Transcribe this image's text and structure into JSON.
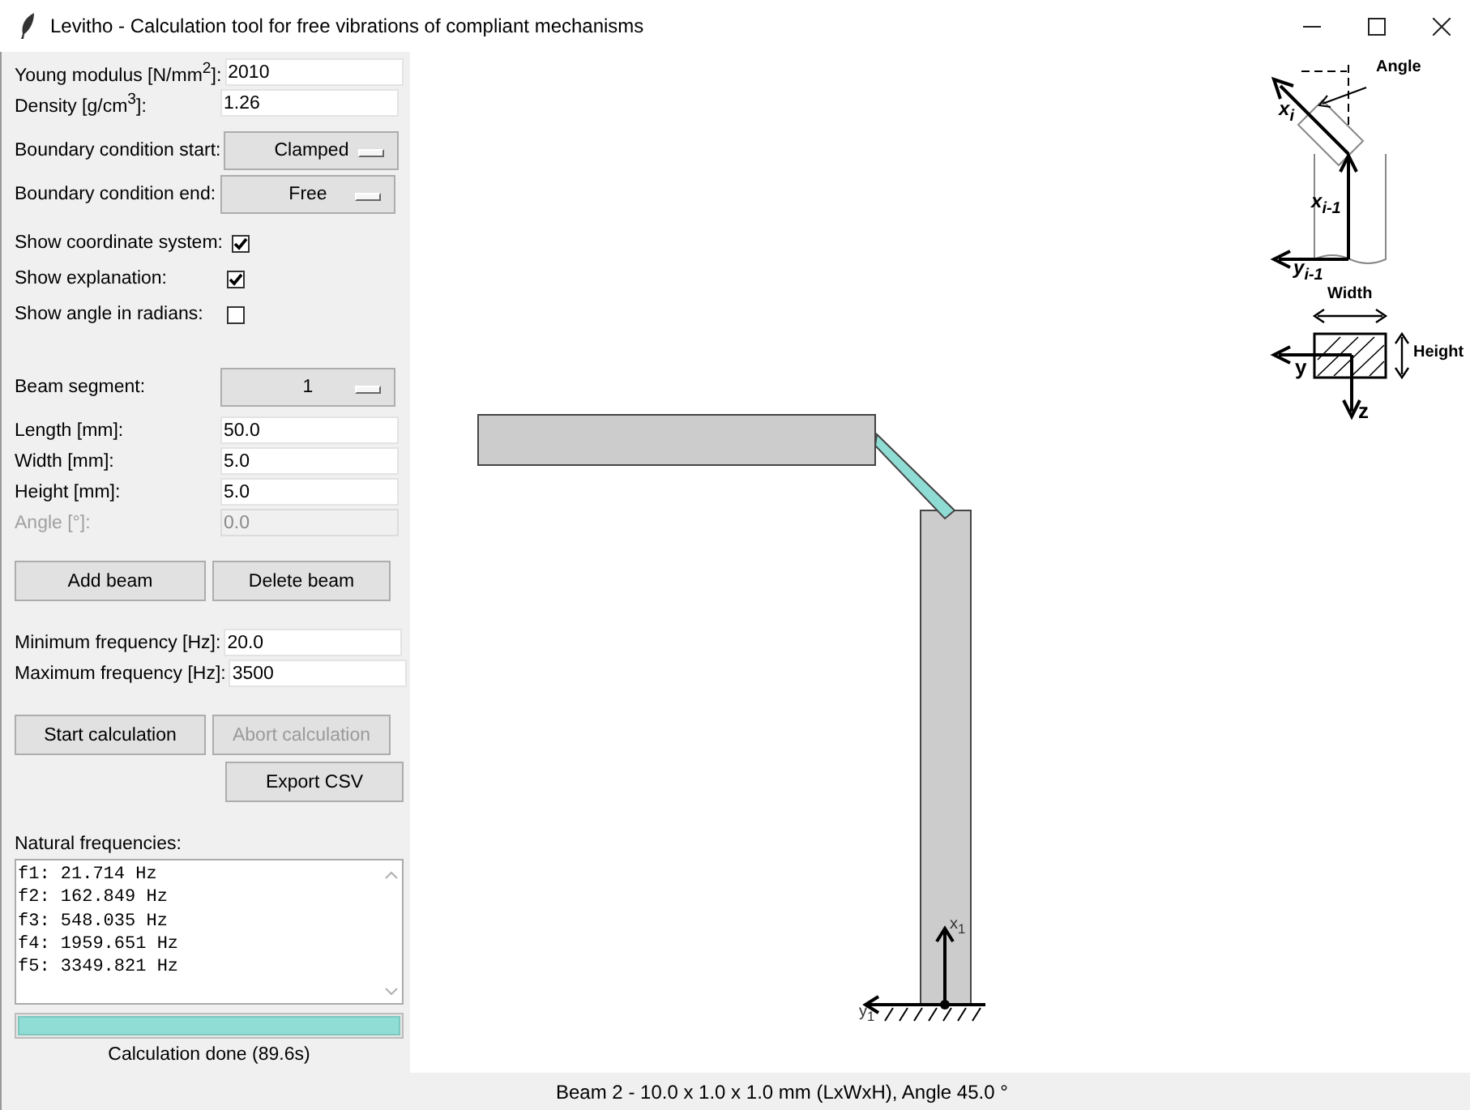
{
  "window": {
    "title": "Levitho - Calculation tool for free vibrations of compliant mechanisms"
  },
  "material": [
    {
      "label": "Young modulus [N/mm$^{2}$]:",
      "value": "2010"
    },
    {
      "label": "Density [g/cm$^{3}$]:",
      "value": "1.26"
    }
  ],
  "boundary": [
    {
      "label": "Boundary condition start:",
      "value": "Clamped"
    },
    {
      "label": "Boundary condition end:",
      "value": "Free"
    }
  ],
  "options": [
    {
      "label": "Show coordinate system:",
      "checked": true
    },
    {
      "label": "Show explanation:",
      "checked": true
    },
    {
      "label": "Show angle in radians:",
      "checked": false
    }
  ],
  "beam_segment": {
    "label": "Beam segment:",
    "value": "1"
  },
  "beam_fields": [
    {
      "label": "Length [mm]:",
      "value": "50.0",
      "disabled": false
    },
    {
      "label": "Width [mm]:",
      "value": "5.0",
      "disabled": false
    },
    {
      "label": "Height [mm]:",
      "value": "5.0",
      "disabled": false
    },
    {
      "label": "Angle [°]:",
      "value": "0.0",
      "disabled": true
    }
  ],
  "beam_buttons": [
    {
      "label": "Add beam",
      "disabled": false
    },
    {
      "label": "Delete beam",
      "disabled": false
    }
  ],
  "frequency_fields": [
    {
      "label": "Minimum frequency [Hz]:",
      "value": "20.0"
    },
    {
      "label": "Maximum frequency [Hz]:",
      "value": "3500"
    }
  ],
  "calc_buttons": [
    {
      "label": "Start calculation",
      "disabled": false
    },
    {
      "label": "Abort calculation",
      "disabled": true
    }
  ],
  "export_button": {
    "label": "Export CSV",
    "disabled": false
  },
  "results": {
    "label": "Natural frequencies:",
    "lines": [
      "f1: 21.714 Hz",
      "f2: 162.849 Hz",
      "f3: 548.035 Hz",
      "f4: 1959.651 Hz",
      "f5: 3349.821 Hz"
    ]
  },
  "progress": {
    "level": 1.0,
    "status": "Calculation done (89.6s)"
  },
  "canvas": {
    "beams": [
      {
        "selected": false
      },
      {
        "selected": true
      },
      {
        "selected": false
      }
    ],
    "axis_labels": [
      "x$_{1}$",
      "y$_{1}$"
    ],
    "explanation": {
      "angle": "Angle",
      "x_i": "x$_{i}$",
      "x_prev": "x$_{i-1}$",
      "y_prev": "y$_{i-1}$",
      "width": "Width",
      "height": "Height",
      "y": "y",
      "z": "z"
    }
  },
  "status_bar": "Beam 2 - 10.0 x 1.0 x 1.0 mm (LxWxH), Angle 45.0 °"
}
